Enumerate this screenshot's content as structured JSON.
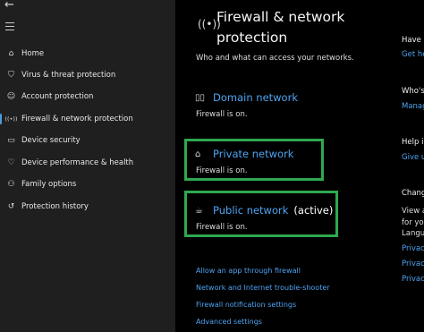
{
  "window": {
    "back_label": "←"
  },
  "sidebar": {
    "items": [
      {
        "label": "Home",
        "icon": "home-icon",
        "glyph": "⌂"
      },
      {
        "label": "Virus & threat protection",
        "icon": "shield-icon",
        "glyph": "⛉"
      },
      {
        "label": "Account protection",
        "icon": "person-icon",
        "glyph": "☺"
      },
      {
        "label": "Firewall & network protection",
        "icon": "wifi-antenna-icon",
        "glyph": "((•))",
        "active": true
      },
      {
        "label": "Device security",
        "icon": "laptop-icon",
        "glyph": "▭"
      },
      {
        "label": "Device performance & health",
        "icon": "heart-icon",
        "glyph": "♡"
      },
      {
        "label": "Family options",
        "icon": "family-icon",
        "glyph": "⚇"
      },
      {
        "label": "Protection history",
        "icon": "history-icon",
        "glyph": "↺"
      }
    ]
  },
  "main": {
    "title": "Firewall & network protection",
    "subtitle": "Who and what can access your networks.",
    "networks": [
      {
        "name": "Domain network",
        "status": "Firewall is on.",
        "icon": "domain-network-icon",
        "glyph": "▯▯",
        "active_label": ""
      },
      {
        "name": "Private network",
        "status": "Firewall is on.",
        "icon": "private-network-icon",
        "glyph": "⌂",
        "active_label": ""
      },
      {
        "name": "Public network",
        "status": "Firewall is on.",
        "icon": "public-network-icon",
        "glyph": "☕",
        "active_label": "(active)"
      }
    ],
    "links": [
      "Allow an app through firewall",
      "Network and Internet trouble-shooter",
      "Firewall notification settings",
      "Advanced settings"
    ]
  },
  "right_panel": {
    "have_a_question": "Have a",
    "get_help": "Get he",
    "whos_protecting": "Who's",
    "manage": "Manag",
    "help_improve": "Help in",
    "give_us": "Give u",
    "change_privacy": "Chang",
    "privacy_text_1": "View a",
    "privacy_text_2": "for you",
    "privacy_text_3": "Langu",
    "privacy_link_1": "Privac",
    "privacy_link_2": "Privac",
    "privacy_link_3": "Privac"
  },
  "colors": {
    "accent": "#4fa3f0",
    "highlight": "#2fa84f",
    "sidebar_bg": "#1f1f1f",
    "main_bg": "#000000"
  }
}
